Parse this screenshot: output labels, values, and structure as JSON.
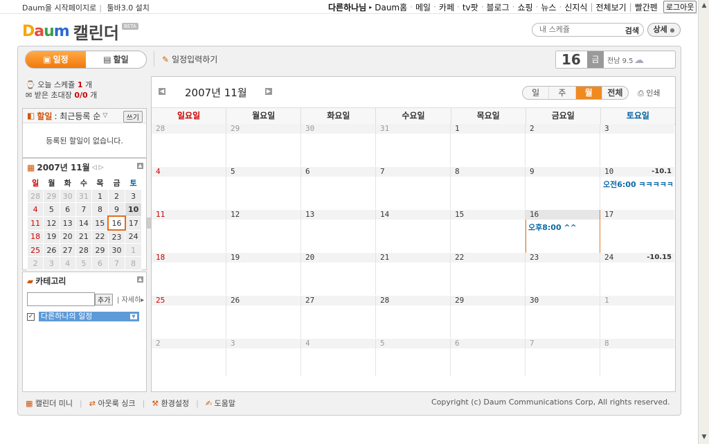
{
  "topbar": {
    "start_page": "Daum을 시작페이지로",
    "toolbar": "툴바3.0 설치",
    "nav": [
      "다른하나님",
      "Daum홈",
      "메일",
      "카페",
      "tv팟",
      "블로그",
      "쇼핑",
      "뉴스",
      "신지식",
      "전체보기",
      "빨간펜"
    ],
    "logout": "로그아웃"
  },
  "brand": {
    "logo": "Daum",
    "title": "캘린더",
    "beta": "BETA"
  },
  "search": {
    "placeholder": "내 스케쥴",
    "button": "검색",
    "detail": "상세"
  },
  "toolbar": {
    "tab_schedule": "일정",
    "tab_todo": "할일",
    "entry": "일정입력하기",
    "date_day": "16",
    "date_weekday": "금",
    "weather": "전남 9.5"
  },
  "summary": {
    "today_label": "오늘 스케쥴",
    "today_count": "1",
    "today_unit": "개",
    "invite_label": "받은 초대장",
    "invite_count": "0/0",
    "invite_unit": "개"
  },
  "todo": {
    "title": "할일",
    "sort": ": 최근등록 순",
    "write": "쓰기",
    "empty": "등록된 할일이 없습니다."
  },
  "minical": {
    "title": "2007년 11월",
    "weekdays": [
      "일",
      "월",
      "화",
      "수",
      "목",
      "금",
      "토"
    ],
    "weeks": [
      [
        "28",
        "29",
        "30",
        "31",
        "1",
        "2",
        "3"
      ],
      [
        "4",
        "5",
        "6",
        "7",
        "8",
        "9",
        "10"
      ],
      [
        "11",
        "12",
        "13",
        "14",
        "15",
        "16",
        "17"
      ],
      [
        "18",
        "19",
        "20",
        "21",
        "22",
        "23",
        "24"
      ],
      [
        "25",
        "26",
        "27",
        "28",
        "29",
        "30",
        "1"
      ],
      [
        "2",
        "3",
        "4",
        "5",
        "6",
        "7",
        "8"
      ]
    ]
  },
  "category": {
    "title": "카테고리",
    "add": "추가",
    "more": "자세히",
    "item": "다른하나의 일정"
  },
  "calendar": {
    "month": "2007년 11월",
    "views": [
      "일",
      "주",
      "월",
      "전체"
    ],
    "print": "인쇄",
    "weekdays": [
      "일요일",
      "월요일",
      "화요일",
      "수요일",
      "목요일",
      "금요일",
      "토요일"
    ],
    "weeks": [
      [
        {
          "d": "28"
        },
        {
          "d": "29"
        },
        {
          "d": "30"
        },
        {
          "d": "31"
        },
        {
          "d": "1"
        },
        {
          "d": "2"
        },
        {
          "d": "3"
        }
      ],
      [
        {
          "d": "4"
        },
        {
          "d": "5"
        },
        {
          "d": "6"
        },
        {
          "d": "7"
        },
        {
          "d": "8"
        },
        {
          "d": "9"
        },
        {
          "d": "10",
          "lunar": "-10.1",
          "ev": "오전6:00 ㅋㅋㅋㅋㅋ"
        }
      ],
      [
        {
          "d": "11"
        },
        {
          "d": "12"
        },
        {
          "d": "13"
        },
        {
          "d": "14"
        },
        {
          "d": "15"
        },
        {
          "d": "16",
          "ev": "오후8:00 ^^"
        },
        {
          "d": "17"
        }
      ],
      [
        {
          "d": "18"
        },
        {
          "d": "19"
        },
        {
          "d": "20"
        },
        {
          "d": "21"
        },
        {
          "d": "22"
        },
        {
          "d": "23"
        },
        {
          "d": "24",
          "lunar": "-10.15"
        }
      ],
      [
        {
          "d": "25"
        },
        {
          "d": "26"
        },
        {
          "d": "27"
        },
        {
          "d": "28"
        },
        {
          "d": "29"
        },
        {
          "d": "30"
        },
        {
          "d": "1"
        }
      ],
      [
        {
          "d": "2"
        },
        {
          "d": "3"
        },
        {
          "d": "4"
        },
        {
          "d": "5"
        },
        {
          "d": "6"
        },
        {
          "d": "7"
        },
        {
          "d": "8"
        }
      ]
    ]
  },
  "footer": {
    "links": [
      "캘린더 미니",
      "아웃룩 싱크",
      "환경설정",
      "도움말"
    ],
    "copyright": "Copyright (c) Daum Communications Corp, All rights reserved."
  },
  "colors": {
    "accent": "#f08a1e",
    "sunday": "#cc0000",
    "saturday": "#005fa3",
    "event": "#0b6aa8"
  }
}
